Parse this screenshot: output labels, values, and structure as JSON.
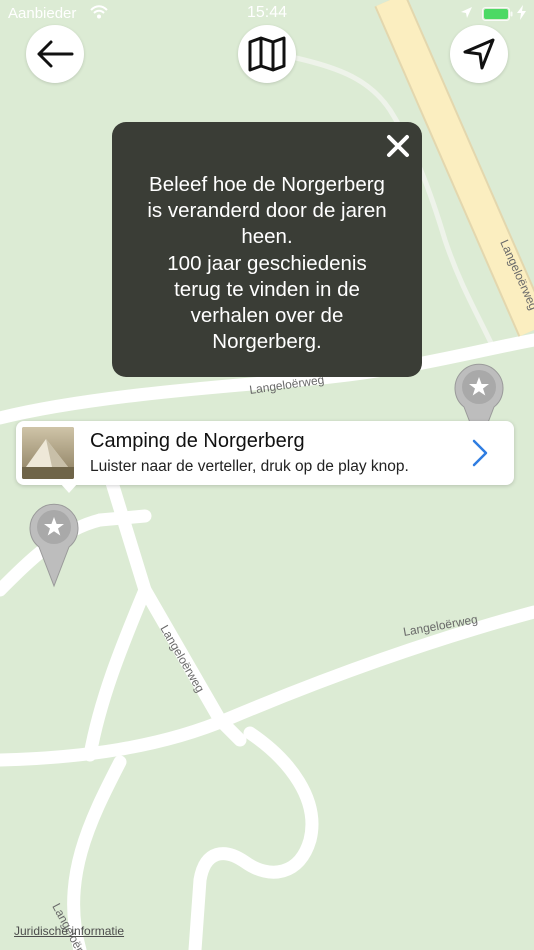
{
  "status_bar": {
    "carrier": "Aanbieder",
    "time": "15:44"
  },
  "map": {
    "street_labels": [
      "Langeloërweg",
      "Langeloërweg",
      "Langeloërweg",
      "Langeloërweg",
      "Langeloërweg",
      "Langeloërweg"
    ],
    "legal_link": "Juridische informatie"
  },
  "buttons": {
    "back_icon": "arrow-left-icon",
    "map_icon": "folded-map-icon",
    "locate_icon": "navigation-arrow-icon"
  },
  "info_popup": {
    "lines": [
      "Beleef hoe de Norgerberg",
      "is veranderd door de jaren",
      "heen.",
      "100 jaar geschiedenis",
      "terug te vinden in de",
      "verhalen over de",
      "Norgerberg."
    ]
  },
  "callout": {
    "title": "Camping de Norgerberg",
    "subtitle": "Luister naar de verteller, druk op de play knop."
  },
  "colors": {
    "map_background": "#dcebd4",
    "road": "#ffffff",
    "main_road": "#fbeec0",
    "popup_background": "#3a3d36",
    "accent": "#2f7de1"
  }
}
